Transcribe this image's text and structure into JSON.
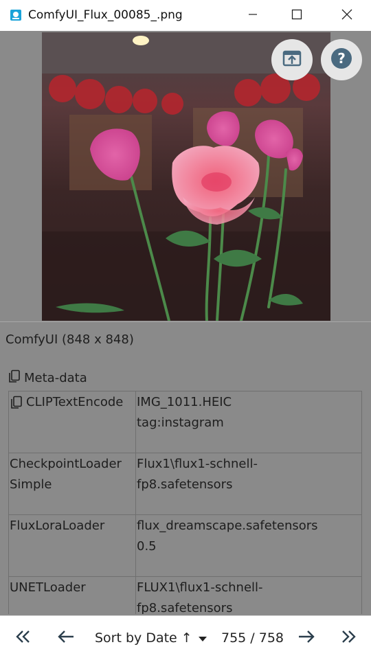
{
  "window": {
    "title": "ComfyUI_Flux_00085_.png",
    "icon": "image-viewer-icon",
    "controls": [
      "minimize-icon",
      "maximize-icon",
      "close-icon"
    ]
  },
  "viewer": {
    "image_alt": "Photo of pink roses and a pink lily in a room",
    "buttons": [
      "open-external-icon",
      "help-icon"
    ]
  },
  "info": {
    "dimensions": "ComfyUI (848 x 848)",
    "metadata_label": "Meta-data"
  },
  "metadata": [
    {
      "key": "CLIPTextEncode",
      "value": "IMG_1011.HEIC\ntag:instagram",
      "copy_icon": true
    },
    {
      "key": "CheckpointLoader\nSimple",
      "value": "Flux1\\flux1-schnell-\nfp8.safetensors",
      "copy_icon": false
    },
    {
      "key": "FluxLoraLoader",
      "value": "flux_dreamscape.safetensors\n0.5",
      "copy_icon": false
    },
    {
      "key": "UNETLoader",
      "value": "FLUX1\\flux1-schnell-\nfp8.safetensors",
      "copy_icon": false
    }
  ],
  "nav": {
    "sort_label": "Sort by Date ↑",
    "counter": "755 / 758"
  },
  "colors": {
    "overlay": "#8a8a8a",
    "accent": "#4a6a80"
  }
}
